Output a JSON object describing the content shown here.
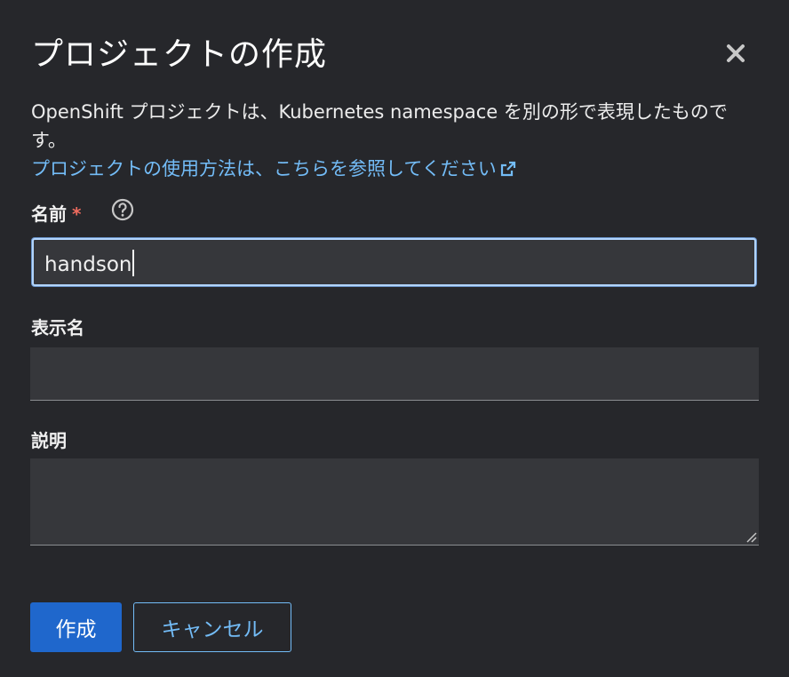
{
  "modal": {
    "title": "プロジェクトの作成",
    "description": "OpenShift プロジェクトは、Kubernetes namespace を別の形で表現したものです。",
    "link_text": "プロジェクトの使用方法は、こちらを参照してください"
  },
  "fields": {
    "name_label": "名前",
    "name_required": "*",
    "name_value": "handson",
    "display_name_label": "表示名",
    "display_name_value": "",
    "description_label": "説明",
    "description_value": ""
  },
  "buttons": {
    "create": "作成",
    "cancel": "キャンセル"
  },
  "icons": {
    "close": "close-icon",
    "help": "help-circle-icon",
    "external_link": "external-link-icon",
    "resize": "resize-handle-icon"
  },
  "colors": {
    "background": "#26272b",
    "link": "#73bcf7",
    "primary": "#1f67cc",
    "focus_border": "#b2d5ff",
    "required": "#ee6b5e"
  }
}
